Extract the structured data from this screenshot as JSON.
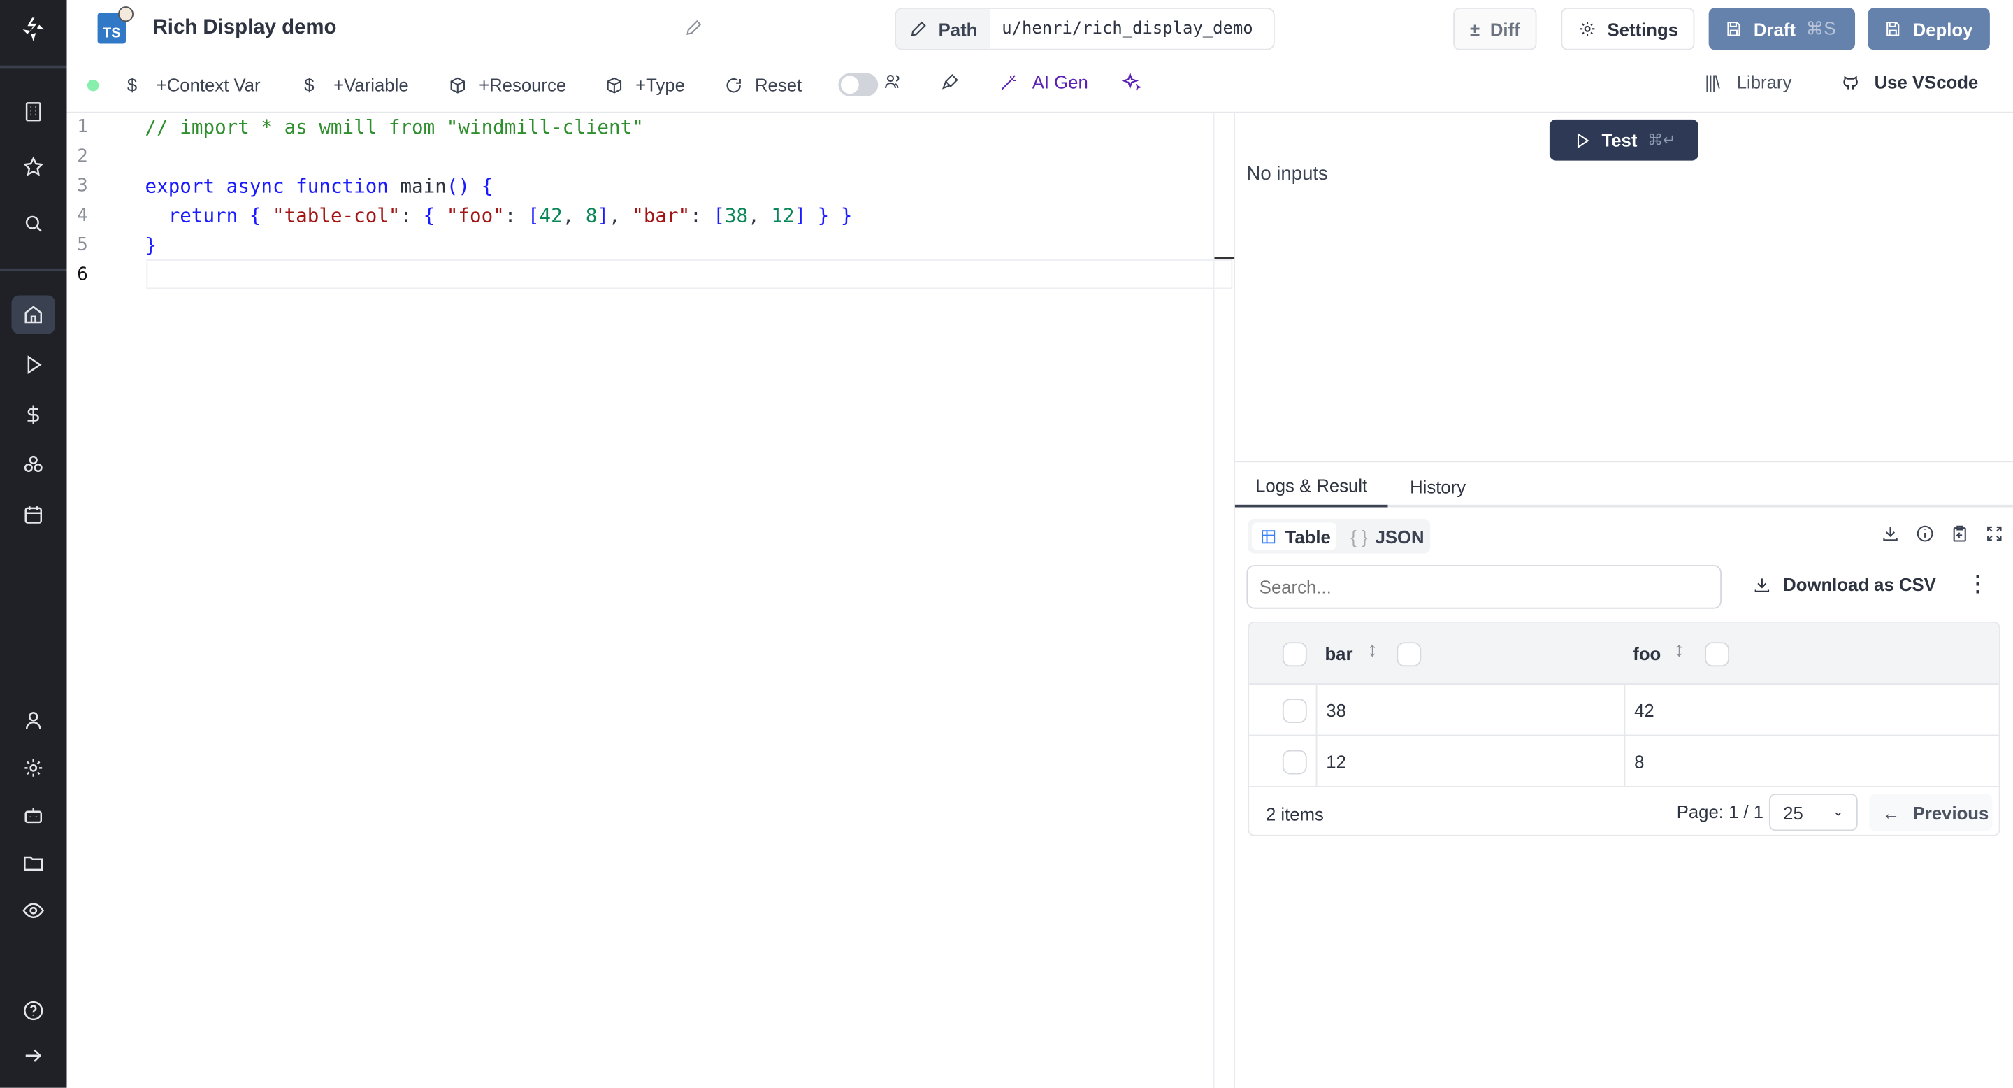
{
  "header": {
    "title": "Rich Display demo",
    "language_badge": "TS",
    "path_label": "Path",
    "path_value": "u/henri/rich_display_demo",
    "diff": "Diff",
    "settings": "Settings",
    "draft": "Draft",
    "draft_shortcut": "⌘S",
    "deploy": "Deploy"
  },
  "toolbar": {
    "context_var": "+Context Var",
    "variable": "+Variable",
    "resource": "+Resource",
    "type": "+Type",
    "reset": "Reset",
    "ai_gen": "AI Gen",
    "library": "Library",
    "use_vscode": "Use VScode",
    "status_color": "#86efac",
    "ai_color": "#5b21b6"
  },
  "sidebar": {
    "icons": [
      "windmill-logo",
      "building-icon",
      "star-icon",
      "search-icon",
      "home-icon",
      "play-icon",
      "dollar-icon",
      "boxes-icon",
      "calendar-icon",
      "user-icon",
      "gear-icon",
      "bot-icon",
      "folder-icon",
      "eye-icon",
      "help-icon",
      "arrow-right-icon"
    ],
    "active": "home-icon"
  },
  "editor": {
    "lines": [
      "// import * as wmill from \"windmill-client\"",
      "",
      "export async function main() {",
      "  return { \"table-col\": { \"foo\": [42, 8], \"bar\": [38, 12] } }",
      "}",
      ""
    ],
    "line_numbers": [
      "1",
      "2",
      "3",
      "4",
      "5",
      "6"
    ]
  },
  "right": {
    "test": "Test",
    "test_shortcut": "⌘↵",
    "no_inputs": "No inputs",
    "tabs": [
      "Logs & Result",
      "History"
    ],
    "view_toggle": [
      "Table",
      "JSON"
    ],
    "search_placeholder": "Search...",
    "download_csv": "Download as CSV",
    "table": {
      "columns": [
        "bar",
        "foo"
      ],
      "rows": [
        [
          "38",
          "42"
        ],
        [
          "12",
          "8"
        ]
      ]
    },
    "footer": {
      "items": "2 items",
      "page": "Page: 1 / 1",
      "page_size": "25",
      "previous": "Previous"
    }
  },
  "colors": {
    "sidebar": "#1f2127",
    "primary": "#6582ad",
    "test_button": "#2e3a55"
  }
}
